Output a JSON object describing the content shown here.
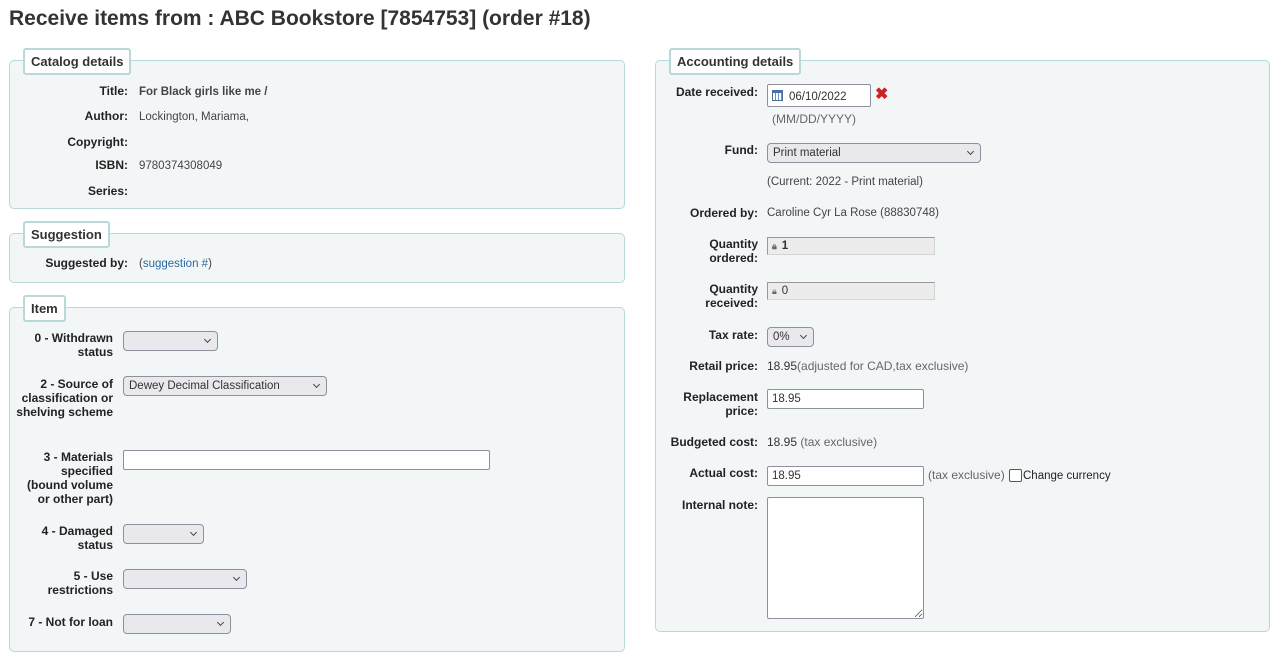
{
  "page": {
    "title": "Receive items from : ABC Bookstore [7854753] (order #18)"
  },
  "catalog": {
    "legend": "Catalog details",
    "title_label": "Title:",
    "title_value": "For Black girls like me /",
    "author_label": "Author:",
    "author_value": "Lockington, Mariama,",
    "copyright_label": "Copyright:",
    "copyright_value": "",
    "isbn_label": "ISBN:",
    "isbn_value": "9780374308049",
    "series_label": "Series:",
    "series_value": ""
  },
  "suggestion": {
    "legend": "Suggestion",
    "suggested_by_label": "Suggested by:",
    "paren_open": "(",
    "link_text": "suggestion #",
    "paren_close": ")"
  },
  "item": {
    "legend": "Item",
    "fields": [
      {
        "label": "0 - Withdrawn status",
        "type": "select",
        "value": ""
      },
      {
        "label": "2 - Source of classification or shelving scheme",
        "type": "select",
        "value": "Dewey Decimal Classification"
      },
      {
        "label": "3 - Materials specified (bound volume or other part)",
        "type": "text",
        "value": ""
      },
      {
        "label": "4 - Damaged status",
        "type": "select",
        "value": ""
      },
      {
        "label": "5 - Use restrictions",
        "type": "select",
        "value": ""
      },
      {
        "label": "7 - Not for loan",
        "type": "select",
        "value": ""
      }
    ]
  },
  "accounting": {
    "legend": "Accounting details",
    "date_received_label": "Date received:",
    "date_received_value": "06/10/2022",
    "date_format_hint": "(MM/DD/YYYY)",
    "fund_label": "Fund:",
    "fund_value": "Print material",
    "fund_current": "(Current: 2022 - Print material)",
    "ordered_by_label": "Ordered by:",
    "ordered_by_value": "Caroline Cyr La Rose (88830748)",
    "qty_ordered_label": "Quantity ordered:",
    "qty_ordered_value": "1",
    "qty_received_label": "Quantity received:",
    "qty_received_value": "0",
    "tax_rate_label": "Tax rate:",
    "tax_rate_value": "0%",
    "retail_price_label": "Retail price:",
    "retail_price_value": "18.95",
    "retail_price_note": "(adjusted for CAD,tax exclusive)",
    "replacement_price_label": "Replacement price:",
    "replacement_price_value": "18.95",
    "budgeted_cost_label": "Budgeted cost:",
    "budgeted_cost_value": "18.95",
    "budgeted_cost_note": "(tax exclusive)",
    "actual_cost_label": "Actual cost:",
    "actual_cost_value": "18.95",
    "actual_cost_note": "(tax exclusive)",
    "change_currency_label": "Change currency",
    "change_currency_checked": false,
    "internal_note_label": "Internal note:",
    "internal_note_value": ""
  },
  "colors": {
    "fieldset_bg": "#f3f6f7",
    "fieldset_border": "#b9d8d9",
    "link": "#2b6aa0",
    "clear_icon": "#cc2222"
  }
}
